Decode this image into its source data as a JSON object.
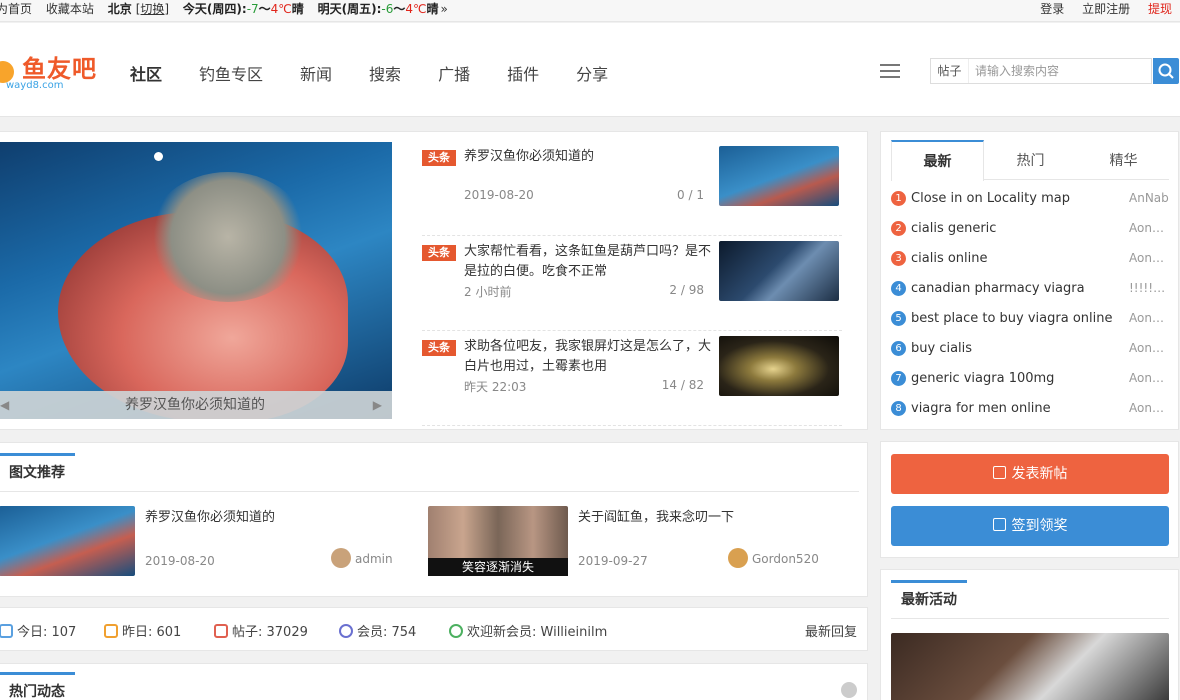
{
  "topbar": {
    "home": "为首页",
    "fav": "收藏本站",
    "city": "北京",
    "switch": "[切换]",
    "today_label": "今天(周四):",
    "today_temp_low": "-7",
    "today_sep": "～",
    "today_temp_high": "4℃",
    "today_cond": "晴",
    "tomorrow_label": "明天(周五):",
    "tomorrow_temp_low": "-6",
    "tomorrow_temp_high": "4℃",
    "tomorrow_cond": "晴",
    "more": "»",
    "login": "登录",
    "register": "立即注册",
    "withdraw": "提现"
  },
  "header": {
    "logo_text": "鱼友吧",
    "logo_url": "wayd8.com",
    "nav": [
      "社区",
      "钓鱼专区",
      "新闻",
      "搜索",
      "广播",
      "插件",
      "分享"
    ],
    "search_category": "帖子",
    "search_placeholder": "请输入搜索内容"
  },
  "slider": {
    "caption": "养罗汉鱼你必须知道的",
    "prev": "◀",
    "next": "▶"
  },
  "headlines": {
    "tag": "头条",
    "items": [
      {
        "title": "养罗汉鱼你必须知道的",
        "time": "2019-08-20",
        "count": "0 / 1"
      },
      {
        "title": "大家帮忙看看，这条缸鱼是葫芦口吗？是不是拉的白便。吃食不正常",
        "time": "2 小时前",
        "count": "2 / 98"
      },
      {
        "title": "求助各位吧友，我家银屏灯这是怎么了，大白片也用过，土霉素也用",
        "time": "昨天 22:03",
        "count": "14 / 82"
      }
    ]
  },
  "picks": {
    "heading": "图文推荐",
    "items": [
      {
        "title": "养罗汉鱼你必须知道的",
        "date": "2019-08-20",
        "author": "admin"
      },
      {
        "title": "关于阎缸鱼，我来念叨一下",
        "date": "2019-09-27",
        "author": "Gordon520",
        "img_caption": "笑容逐渐消失"
      }
    ]
  },
  "stats": {
    "today": "今日: 107",
    "yesterday": "昨日: 601",
    "posts": "帖子: 37029",
    "members": "会员: 754",
    "welcome": "欢迎新会员: Willieinilm",
    "latest_reply": "最新回复"
  },
  "hot": {
    "heading": "热门动态"
  },
  "sidebar": {
    "tabs": [
      "最新",
      "热门",
      "精华"
    ],
    "list": [
      {
        "num": "1",
        "title": "Close in on Locality map",
        "author": "AnNab"
      },
      {
        "num": "2",
        "title": "cialis generic",
        "author": "Aonk..."
      },
      {
        "num": "3",
        "title": "cialis online",
        "author": "Aonk..."
      },
      {
        "num": "4",
        "title": "canadian pharmacy viagra",
        "author": "!!!!!Af..."
      },
      {
        "num": "5",
        "title": "best place to buy viagra online",
        "author": "Aonk..."
      },
      {
        "num": "6",
        "title": "buy cialis",
        "author": "Aonk..."
      },
      {
        "num": "7",
        "title": "generic viagra 100mg",
        "author": "Aonk..."
      },
      {
        "num": "8",
        "title": "viagra for men online",
        "author": "Aonk..."
      }
    ],
    "new_post": "发表新帖",
    "checkin": "签到领奖",
    "events_heading": "最新活动"
  },
  "colors": {
    "accent": "#3b8dd6",
    "new_post_btn": "#ee6340",
    "checkin_btn": "#3b8dd6",
    "rank_top": "#ee6340",
    "rank_other": "#3b8dd6",
    "headline_tag": "#e5582f"
  },
  "icons": {
    "search": "search-icon",
    "menu": "menu-icon",
    "edit": "edit-icon",
    "calendar": "calendar-icon"
  }
}
